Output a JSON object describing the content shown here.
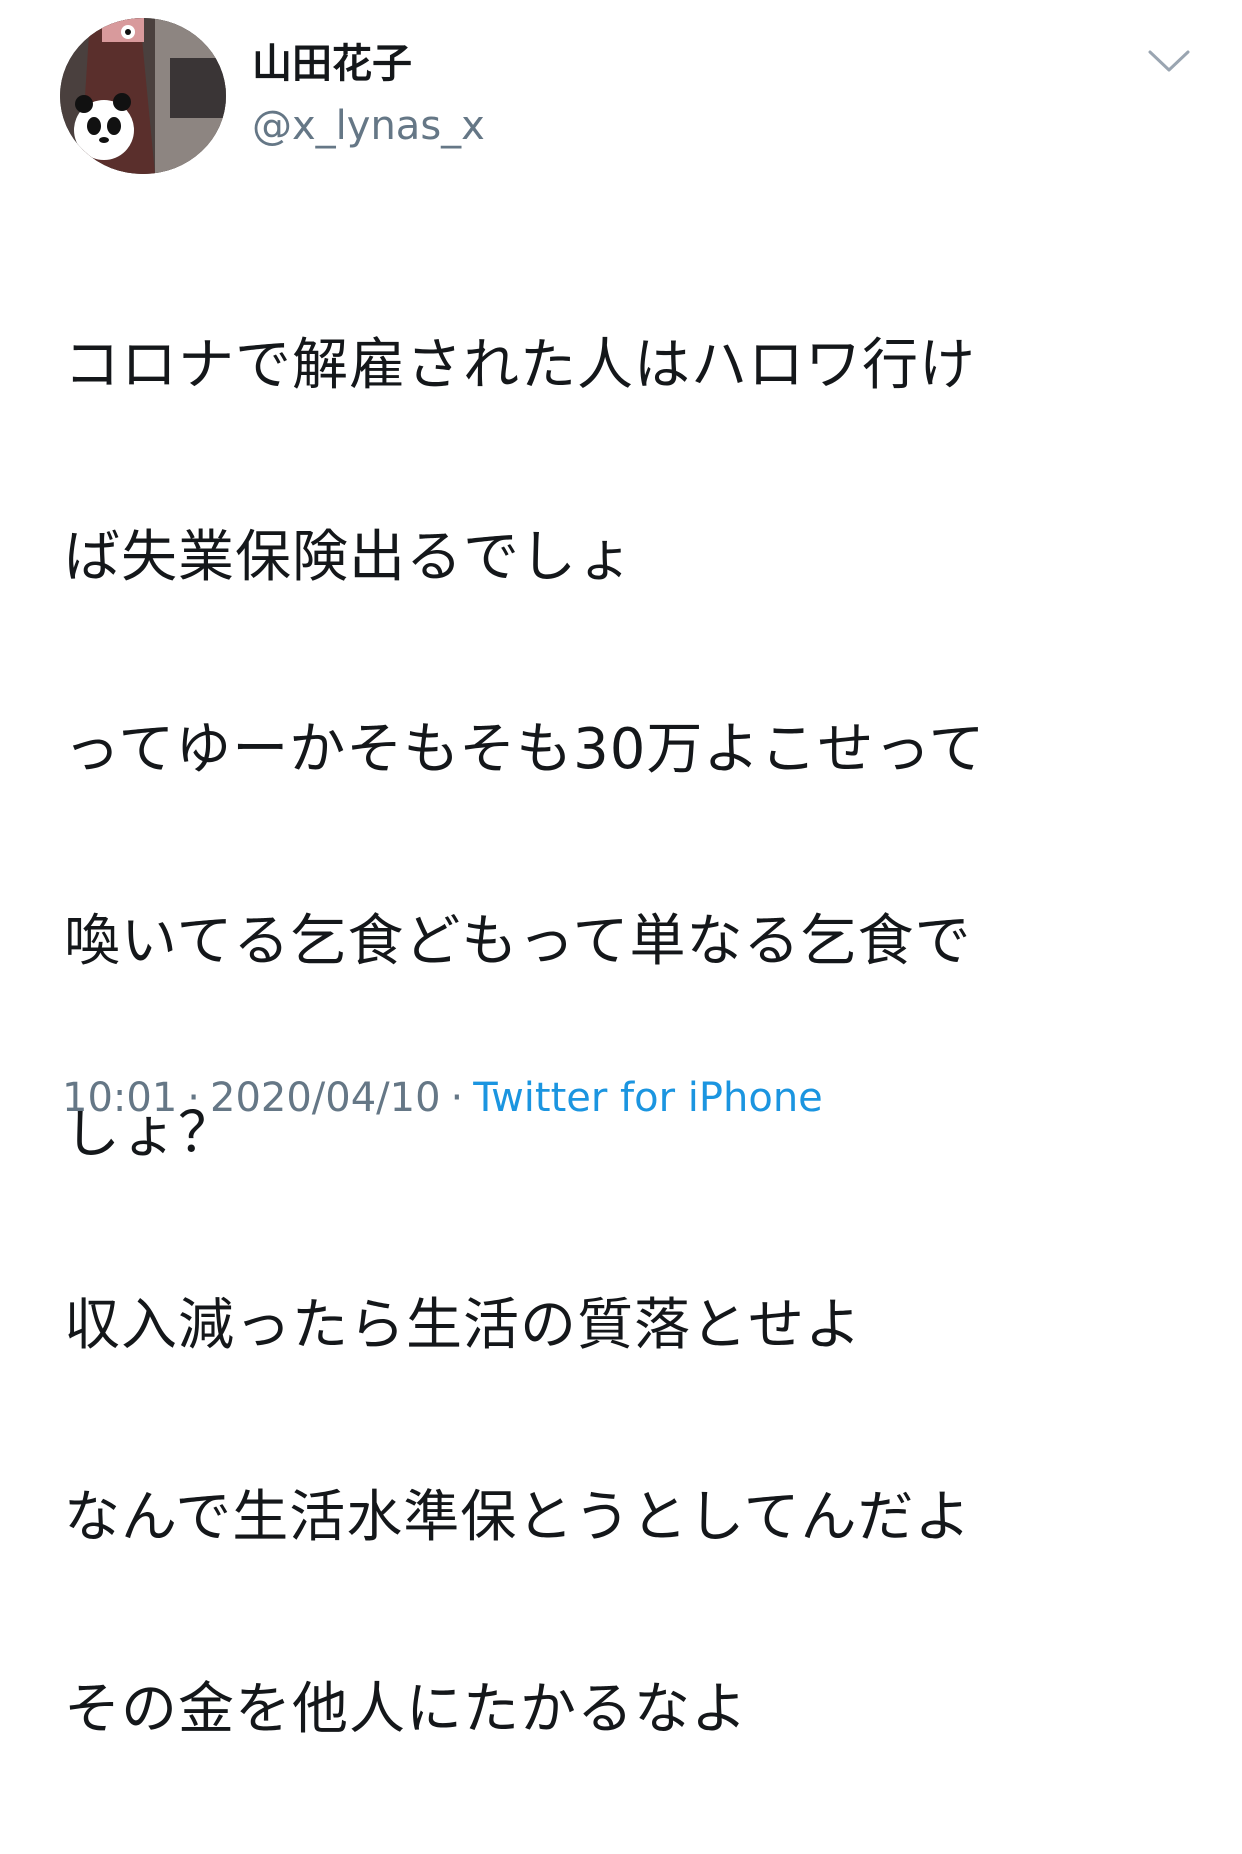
{
  "user": {
    "display_name": "山田花子",
    "handle": "@x_lynas_x"
  },
  "header": {
    "menu_icon": "chevron-down-icon"
  },
  "tweet": {
    "lines": [
      "コロナで解雇された人はハロワ行け",
      "ば失業保険出るでしょ",
      "ってゆーかそもそも30万よこせって",
      "喚いてる乞食どもって単なる乞食で",
      "しょ？",
      "収入減ったら生活の質落とせよ",
      "なんで生活水準保とうとしてんだよ",
      "その金を他人にたかるなよ"
    ]
  },
  "meta": {
    "time": "10:01",
    "separator": "·",
    "date": "2020/04/10",
    "source": "Twitter for iPhone"
  },
  "colors": {
    "text": "#14171a",
    "secondary": "#657786",
    "link": "#1b95e0"
  }
}
